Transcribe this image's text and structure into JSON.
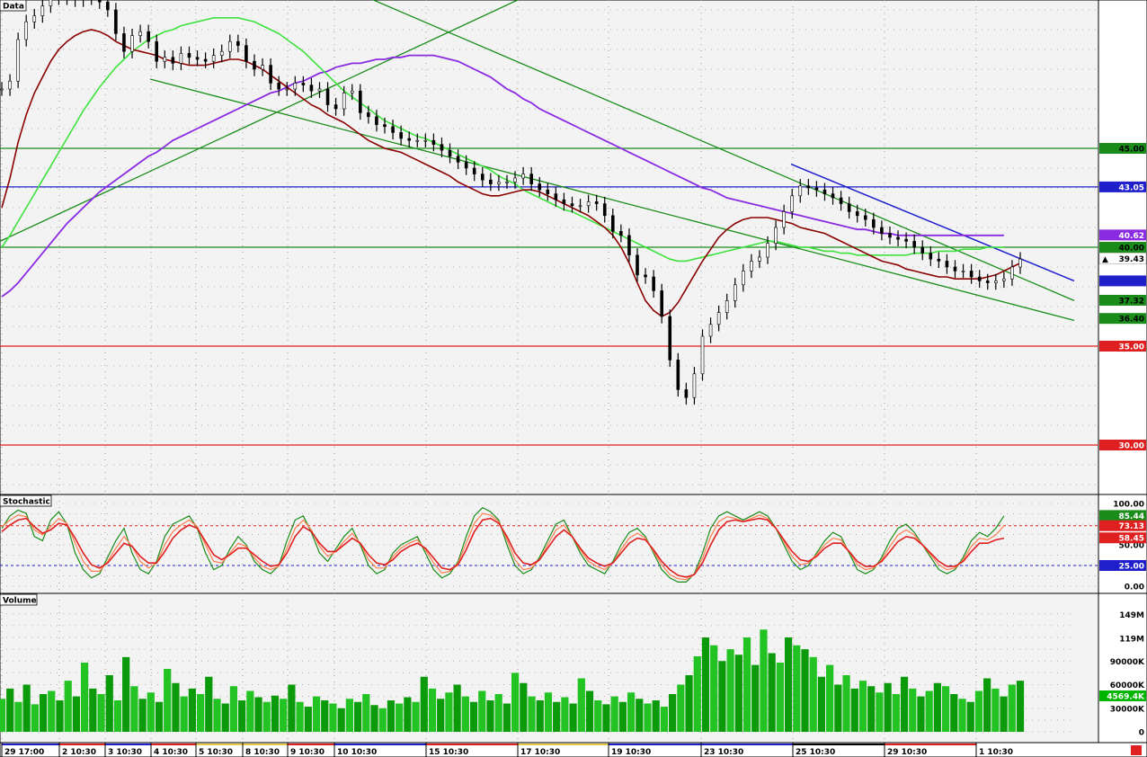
{
  "panels": {
    "price": {
      "title": "Data"
    },
    "stoch": {
      "title": "Stochastic"
    },
    "volume": {
      "title": "Volume"
    }
  },
  "x_labels": [
    "29 17:00",
    "2 10:30",
    "3 10:30",
    "4 10:30",
    "5 10:30",
    "8 10:30",
    "9 10:30",
    "10 10:30",
    "15 10:30",
    "17 10:30",
    "19 10:30",
    "23 10:30",
    "25 10:30",
    "29 10:30",
    "1 10:30"
  ],
  "colors": {
    "green": "#1a8c1a",
    "blue": "#1f1fcc",
    "red": "#e02020",
    "purple": "#8a2be2",
    "dark_red": "#8b0000",
    "light_green": "#3ee23e",
    "candle": "#000000",
    "volume": "#00b400"
  },
  "chart_data": [
    {
      "type": "line",
      "title": "Data",
      "ylim": [
        27.5,
        52.5
      ],
      "horizontal_lines": [
        {
          "value": 45.0,
          "label": "45.00",
          "color": "#1a8c1a"
        },
        {
          "value": 43.05,
          "label": "43.05",
          "color": "#1f1fcc"
        },
        {
          "value": 40.0,
          "label": "40.00",
          "color": "#1a8c1a"
        },
        {
          "value": 35.0,
          "label": "35.00",
          "color": "#e02020"
        },
        {
          "value": 30.0,
          "label": "30.00",
          "color": "#e02020"
        }
      ],
      "price_tags": [
        {
          "value": 40.62,
          "label": "40.62",
          "color": "#8a2be2",
          "text_color": "#ffffff"
        },
        {
          "value": 39.43,
          "label": "39.43",
          "color": "#ffffff",
          "text_color": "#000000",
          "marker": "▲"
        },
        {
          "value": 38.3,
          "label": "",
          "color": "#1f1fcc",
          "text_color": "#ffffff"
        },
        {
          "value": 37.32,
          "label": "37.32",
          "color": "#1a8c1a",
          "text_color": "#000000"
        },
        {
          "value": 36.4,
          "label": "36.40",
          "color": "#1a8c1a",
          "text_color": "#000000"
        }
      ],
      "close": [
        48.0,
        48.4,
        50.5,
        51.4,
        51.7,
        52.2,
        52.6,
        52.6,
        52.8,
        52.5,
        53.0,
        52.6,
        52.4,
        52.0,
        50.8,
        49.9,
        50.7,
        50.9,
        50.4,
        49.4,
        49.6,
        49.3,
        49.8,
        49.6,
        49.5,
        49.4,
        49.7,
        49.9,
        50.4,
        50.2,
        49.4,
        49.0,
        49.2,
        48.3,
        48.0,
        48.0,
        48.3,
        48.2,
        47.9,
        48.0,
        47.2,
        47.0,
        47.8,
        47.9,
        46.8,
        46.6,
        46.2,
        46.1,
        45.8,
        45.5,
        45.4,
        45.4,
        45.4,
        45.2,
        44.9,
        44.6,
        44.3,
        44.0,
        43.7,
        43.4,
        43.2,
        43.3,
        43.3,
        43.5,
        43.7,
        43.2,
        42.9,
        42.7,
        42.4,
        42.2,
        42.1,
        42.1,
        42.3,
        42.2,
        41.6,
        40.8,
        40.6,
        39.6,
        38.6,
        38.5,
        37.8,
        36.5,
        34.3,
        32.8,
        32.4,
        33.6,
        35.5,
        36.1,
        36.7,
        37.3,
        38.1,
        38.8,
        39.3,
        39.5,
        40.2,
        41.0,
        41.8,
        42.6,
        43.1,
        43.0,
        42.9,
        42.7,
        42.5,
        42.2,
        41.8,
        41.6,
        41.4,
        41.0,
        40.7,
        40.5,
        40.4,
        40.3,
        40.0,
        39.7,
        39.4,
        39.3,
        39.0,
        38.8,
        38.8,
        38.5,
        38.3,
        38.2,
        38.3,
        38.4,
        39.0,
        39.4
      ],
      "sma_dark_red": [
        42.0,
        43.5,
        45.3,
        46.7,
        47.8,
        48.6,
        49.4,
        50.0,
        50.4,
        50.7,
        50.9,
        51.0,
        50.9,
        50.7,
        50.4,
        50.2,
        50.0,
        49.9,
        49.8,
        49.7,
        49.5,
        49.4,
        49.3,
        49.2,
        49.2,
        49.2,
        49.3,
        49.4,
        49.5,
        49.5,
        49.4,
        49.2,
        49.0,
        48.7,
        48.4,
        48.1,
        47.8,
        47.5,
        47.2,
        47.0,
        46.7,
        46.5,
        46.3,
        46.0,
        45.7,
        45.4,
        45.2,
        45.0,
        44.9,
        44.8,
        44.6,
        44.4,
        44.2,
        44.0,
        43.8,
        43.6,
        43.3,
        43.1,
        42.9,
        42.7,
        42.6,
        42.6,
        42.7,
        42.8,
        42.9,
        42.9,
        42.8,
        42.6,
        42.4,
        42.2,
        42.0,
        41.8,
        41.6,
        41.3,
        41.0,
        40.6,
        40.0,
        39.2,
        38.2,
        37.3,
        36.8,
        36.5,
        36.7,
        37.2,
        37.9,
        38.6,
        39.3,
        39.9,
        40.5,
        40.9,
        41.2,
        41.4,
        41.5,
        41.5,
        41.5,
        41.4,
        41.3,
        41.2,
        41.0,
        40.9,
        40.8,
        40.7,
        40.5,
        40.3,
        40.1,
        39.9,
        39.7,
        39.5,
        39.3,
        39.2,
        39.1,
        38.9,
        38.8,
        38.7,
        38.6,
        38.5,
        38.5,
        38.4,
        38.4,
        38.4,
        38.4,
        38.5,
        38.6,
        38.8,
        39.0,
        39.2
      ],
      "sma_light_green": [
        40.0,
        40.6,
        41.3,
        42.0,
        42.7,
        43.4,
        44.1,
        44.8,
        45.5,
        46.2,
        46.9,
        47.5,
        48.1,
        48.6,
        49.1,
        49.5,
        49.9,
        50.2,
        50.5,
        50.7,
        50.9,
        51.0,
        51.2,
        51.3,
        51.4,
        51.5,
        51.6,
        51.6,
        51.6,
        51.6,
        51.5,
        51.4,
        51.2,
        51.0,
        50.8,
        50.5,
        50.2,
        49.9,
        49.5,
        49.1,
        48.7,
        48.3,
        47.9,
        47.6,
        47.3,
        47.0,
        46.7,
        46.4,
        46.2,
        46.0,
        45.8,
        45.6,
        45.5,
        45.3,
        45.1,
        44.9,
        44.7,
        44.5,
        44.3,
        44.1,
        43.9,
        43.6,
        43.4,
        43.2,
        42.9,
        42.7,
        42.5,
        42.3,
        42.1,
        41.9,
        41.8,
        41.6,
        41.4,
        41.2,
        41.0,
        40.8,
        40.6,
        40.4,
        40.2,
        40.0,
        39.8,
        39.6,
        39.4,
        39.3,
        39.3,
        39.4,
        39.5,
        39.6,
        39.7,
        39.8,
        39.9,
        40.0,
        40.1,
        40.2,
        40.3,
        40.3,
        40.2,
        40.1,
        40.0,
        40.0,
        39.9,
        39.8,
        39.8,
        39.7,
        39.7,
        39.6,
        39.6,
        39.6,
        39.6,
        39.6,
        39.6,
        39.6,
        39.7,
        39.7,
        39.7,
        39.8,
        39.8,
        39.8,
        39.9,
        39.9,
        39.9,
        40.0,
        40.0,
        40.0
      ],
      "sma_purple": [
        37.5,
        37.8,
        38.2,
        38.7,
        39.2,
        39.7,
        40.2,
        40.7,
        41.2,
        41.6,
        42.0,
        42.4,
        42.8,
        43.1,
        43.4,
        43.7,
        44.0,
        44.3,
        44.6,
        44.8,
        45.1,
        45.4,
        45.6,
        45.8,
        46.0,
        46.2,
        46.4,
        46.6,
        46.8,
        47.0,
        47.2,
        47.4,
        47.6,
        47.8,
        47.9,
        48.1,
        48.3,
        48.4,
        48.6,
        48.8,
        48.9,
        49.1,
        49.2,
        49.3,
        49.3,
        49.4,
        49.5,
        49.5,
        49.6,
        49.6,
        49.7,
        49.7,
        49.7,
        49.7,
        49.6,
        49.5,
        49.4,
        49.2,
        49.0,
        48.8,
        48.6,
        48.3,
        48.0,
        47.8,
        47.5,
        47.3,
        47.0,
        46.8,
        46.6,
        46.4,
        46.2,
        46.0,
        45.8,
        45.6,
        45.4,
        45.2,
        45.0,
        44.8,
        44.6,
        44.4,
        44.2,
        44.0,
        43.8,
        43.6,
        43.4,
        43.2,
        43.0,
        42.9,
        42.7,
        42.5,
        42.4,
        42.3,
        42.2,
        42.1,
        42.0,
        41.9,
        41.8,
        41.7,
        41.6,
        41.5,
        41.4,
        41.3,
        41.2,
        41.1,
        41.0,
        40.9,
        40.9,
        40.8,
        40.7,
        40.7,
        40.6,
        40.6,
        40.6,
        40.6,
        40.6,
        40.6,
        40.6,
        40.6,
        40.6,
        40.6,
        40.6,
        40.6,
        40.6,
        40.6
      ]
    },
    {
      "type": "line",
      "title": "Stochastic",
      "ylim": [
        0,
        100
      ],
      "tick_labels": [
        "100.00",
        "50.00",
        "0.00"
      ],
      "levels": [
        {
          "value": 73.13,
          "label": "73.13",
          "color": "#e02020"
        },
        {
          "value": 25.0,
          "label": "25.00",
          "color": "#1f1fcc"
        }
      ],
      "value_tags": [
        {
          "value": 85.44,
          "label": "85.44",
          "color": "#1a8c1a"
        },
        {
          "value": 73.13,
          "label": "73.13",
          "color": "#e02020"
        },
        {
          "value": 58.45,
          "label": "58.45",
          "color": "#e02020"
        },
        {
          "value": 25.0,
          "label": "25.00",
          "color": "#1f1fcc"
        }
      ],
      "series": [
        {
          "values": [
            70,
            85,
            92,
            88,
            60,
            55,
            80,
            90,
            75,
            40,
            20,
            10,
            15,
            35,
            55,
            70,
            40,
            20,
            15,
            30,
            60,
            75,
            80,
            85,
            70,
            40,
            20,
            25,
            45,
            60,
            50,
            30,
            20,
            15,
            25,
            55,
            80,
            85,
            65,
            40,
            30,
            45,
            60,
            70,
            50,
            25,
            15,
            20,
            40,
            50,
            55,
            60,
            40,
            20,
            10,
            15,
            30,
            60,
            85,
            95,
            90,
            80,
            50,
            25,
            15,
            20,
            35,
            55,
            75,
            80,
            60,
            40,
            25,
            20,
            15,
            30,
            50,
            65,
            70,
            60,
            40,
            20,
            10,
            5,
            5,
            15,
            40,
            70,
            85,
            90,
            85,
            80,
            85,
            90,
            85,
            70,
            50,
            30,
            20,
            25,
            40,
            55,
            65,
            60,
            40,
            20,
            15,
            20,
            35,
            55,
            70,
            75,
            65,
            50,
            35,
            20,
            15,
            20,
            35,
            55,
            65,
            60,
            70,
            85
          ]
        },
        {
          "values": [
            72,
            80,
            86,
            84,
            68,
            62,
            72,
            82,
            76,
            52,
            30,
            18,
            18,
            30,
            46,
            60,
            48,
            30,
            22,
            28,
            50,
            66,
            74,
            80,
            72,
            50,
            30,
            28,
            40,
            52,
            48,
            34,
            24,
            20,
            24,
            46,
            70,
            80,
            68,
            48,
            36,
            42,
            54,
            64,
            52,
            32,
            22,
            22,
            36,
            46,
            52,
            56,
            44,
            28,
            16,
            18,
            28,
            52,
            76,
            88,
            86,
            78,
            56,
            32,
            20,
            22,
            32,
            50,
            68,
            74,
            60,
            44,
            30,
            24,
            20,
            28,
            44,
            58,
            64,
            58,
            42,
            26,
            14,
            9,
            8,
            14,
            34,
            60,
            78,
            84,
            82,
            78,
            82,
            86,
            82,
            70,
            54,
            36,
            26,
            28,
            38,
            50,
            58,
            56,
            42,
            26,
            20,
            22,
            32,
            48,
            62,
            68,
            62,
            50,
            38,
            26,
            20,
            22,
            32,
            48,
            58,
            56,
            62,
            73
          ]
        },
        {
          "values": [
            66,
            74,
            80,
            82,
            72,
            64,
            68,
            76,
            74,
            58,
            40,
            26,
            22,
            28,
            40,
            52,
            48,
            36,
            28,
            28,
            42,
            58,
            68,
            74,
            70,
            54,
            38,
            32,
            38,
            46,
            46,
            38,
            30,
            24,
            26,
            40,
            60,
            72,
            66,
            52,
            42,
            42,
            50,
            58,
            52,
            38,
            28,
            26,
            32,
            42,
            48,
            52,
            46,
            34,
            22,
            20,
            26,
            44,
            66,
            80,
            82,
            76,
            60,
            40,
            28,
            26,
            32,
            46,
            60,
            68,
            60,
            46,
            34,
            28,
            24,
            28,
            40,
            52,
            58,
            56,
            44,
            30,
            20,
            13,
            11,
            14,
            28,
            50,
            68,
            78,
            80,
            78,
            80,
            82,
            80,
            70,
            56,
            42,
            32,
            30,
            36,
            46,
            52,
            52,
            42,
            30,
            24,
            24,
            30,
            42,
            54,
            60,
            58,
            50,
            40,
            30,
            24,
            24,
            30,
            42,
            52,
            52,
            56,
            58
          ]
        }
      ]
    },
    {
      "type": "bar",
      "title": "Volume",
      "tick_labels": [
        "149M",
        "119M",
        "90000K",
        "60000K",
        "30000K",
        "0"
      ],
      "current_label": "4569.4K",
      "values": [
        42,
        55,
        38,
        60,
        35,
        48,
        52,
        40,
        65,
        45,
        88,
        55,
        48,
        72,
        40,
        95,
        58,
        42,
        50,
        38,
        80,
        62,
        45,
        55,
        48,
        70,
        42,
        36,
        58,
        40,
        52,
        44,
        38,
        46,
        42,
        60,
        38,
        32,
        45,
        40,
        36,
        30,
        42,
        38,
        48,
        34,
        30,
        40,
        36,
        44,
        38,
        70,
        55,
        42,
        50,
        60,
        45,
        38,
        52,
        40,
        48,
        36,
        75,
        62,
        45,
        40,
        50,
        38,
        44,
        36,
        68,
        52,
        40,
        35,
        45,
        38,
        50,
        42,
        36,
        40,
        32,
        48,
        60,
        72,
        96,
        120,
        110,
        90,
        105,
        98,
        120,
        85,
        130,
        100,
        88,
        120,
        110,
        105,
        95,
        70,
        85,
        60,
        72,
        55,
        65,
        58,
        50,
        62,
        48,
        70,
        55,
        45,
        52,
        62,
        58,
        48,
        42,
        38,
        52,
        68,
        55,
        45,
        60,
        65
      ]
    }
  ]
}
